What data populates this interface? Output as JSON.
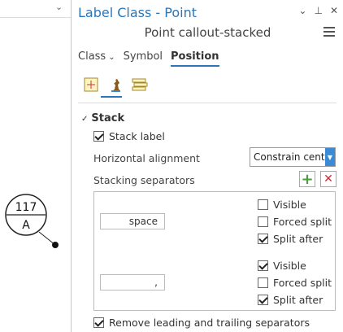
{
  "map": {
    "label_top": "117",
    "label_bottom": "A"
  },
  "panel": {
    "title": "Label Class - Point",
    "subtitle": "Point callout-stacked",
    "tabs": [
      {
        "label": "Class"
      },
      {
        "label": "Symbol"
      },
      {
        "label": "Position"
      }
    ],
    "section": "Stack",
    "stack_label": "Stack label",
    "horizontal_alignment_label": "Horizontal alignment",
    "horizontal_alignment_value": "Constrain center",
    "stacking_separators_label": "Stacking separators",
    "separators": [
      {
        "value": "space",
        "visible": "Visible",
        "forced_split": "Forced split",
        "split_after": "Split after"
      },
      {
        "value": ",",
        "visible": "Visible",
        "forced_split": "Forced split",
        "split_after": "Split after"
      }
    ],
    "remove_separators": "Remove leading and trailing separators"
  },
  "colors": {
    "accent": "#2a76b8",
    "dropdown_arrow": "#3b8ad6",
    "add": "#4a9d3a",
    "delete": "#dd2233"
  }
}
